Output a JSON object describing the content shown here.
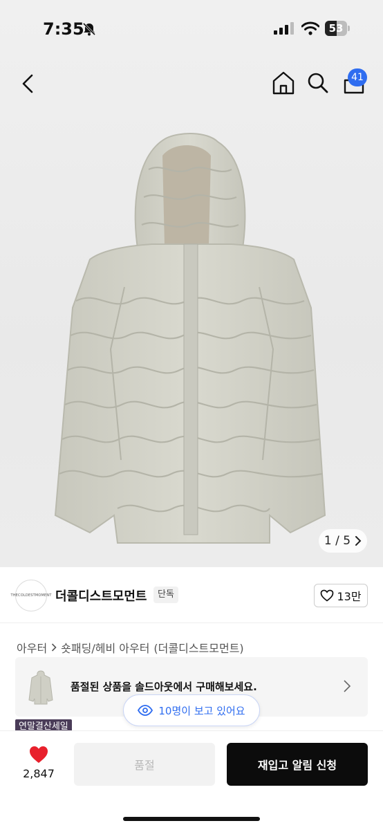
{
  "status_bar": {
    "time": "7:35",
    "battery": "53",
    "battery_level": 0.53
  },
  "nav": {
    "cart_count": "41"
  },
  "gallery": {
    "counter": "1 / 5"
  },
  "brand": {
    "name": "더콜디스트모먼트",
    "logo_text": "THECOLDESTMOMENT",
    "exclusive_badge": "단독",
    "likes": "13만"
  },
  "breadcrumb": {
    "category": "아우터",
    "subcategory": "숏패딩/헤비 아우터",
    "brand_suffix": "(더콜디스트모먼트)"
  },
  "soldout_banner": {
    "text": "품절된 상품을 솔드아웃에서 구매해보세요."
  },
  "viewers": {
    "text": "10명이 보고 있어요"
  },
  "sale_tag": "연말결산세일",
  "bottom_bar": {
    "wish_count": "2,847",
    "soldout_label": "품절",
    "restock_label": "재입고 알림 신청"
  },
  "colors": {
    "accent": "#2f6df0",
    "heart": "#e8202c",
    "sale_tag": "#4a3c58",
    "primary_button": "#0c0c0c"
  }
}
